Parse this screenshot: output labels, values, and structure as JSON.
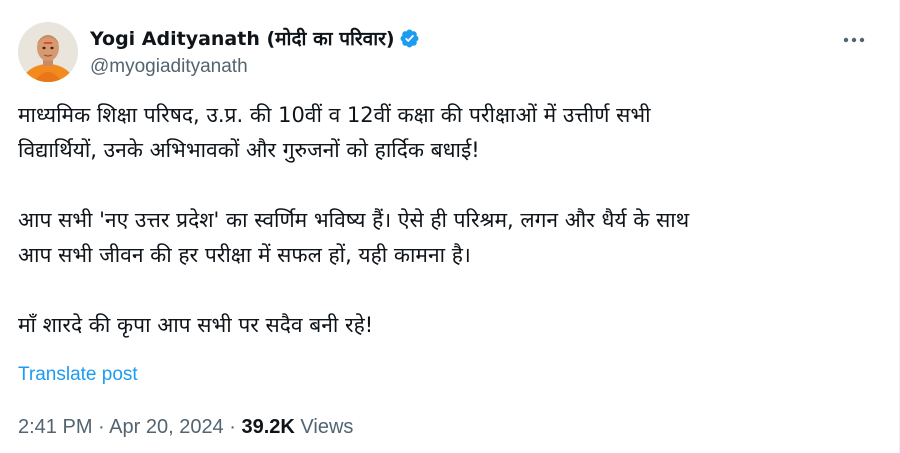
{
  "author": {
    "display_name": "Yogi Adityanath (मोदी का परिवार)",
    "handle": "@myogiadityanath",
    "verified": true
  },
  "icons": {
    "verified": "verified-badge-icon",
    "more": "more-horizontal-icon",
    "avatar": "profile-photo"
  },
  "post": {
    "paragraphs": [
      "माध्यमिक शिक्षा परिषद, उ.प्र. की 10वीं व 12वीं कक्षा की परीक्षाओं में उत्तीर्ण सभी\nविद्यार्थियों, उनके अभिभावकों और गुरुजनों को हार्दिक बधाई!",
      "आप सभी 'नए उत्तर प्रदेश' का स्वर्णिम भविष्य हैं। ऐसे ही परिश्रम, लगन और धैर्य के साथ\nआप सभी जीवन की हर परीक्षा में सफल हों, यही कामना है।",
      "माँ शारदे की कृपा आप सभी पर सदैव बनी रहे!"
    ],
    "translate_label": "Translate post",
    "timestamp": "2:41 PM · Apr 20, 2024",
    "separator": " · ",
    "views_count": "39.2K",
    "views_label": " Views"
  },
  "colors": {
    "accent": "#1d9bf0",
    "text_primary": "#0f1419",
    "text_secondary": "#536471",
    "avatar_robe": "#f28a1e"
  }
}
